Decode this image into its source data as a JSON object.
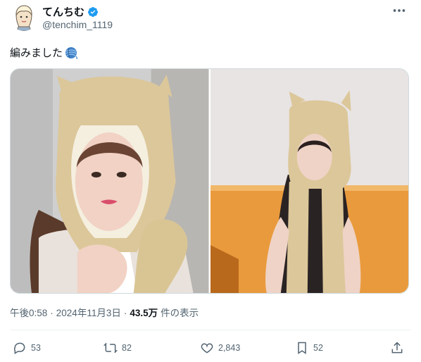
{
  "author": {
    "display_name": "てんちむ",
    "handle": "@tenchim_1119",
    "verified": true,
    "avatar_icon": "illustrated-avatar"
  },
  "tweet": {
    "text": "編みました",
    "emoji_icon": "yarn-ball-icon",
    "image_count": 2
  },
  "meta": {
    "time": "午後0:58",
    "separator": "·",
    "date": "2024年11月3日",
    "views_count": "43.5万",
    "views_label": "件の表示"
  },
  "actions": {
    "replies": "53",
    "reposts": "82",
    "likes": "2,843",
    "bookmarks": "52"
  },
  "colors": {
    "text": "#0f1419",
    "muted": "#536471",
    "verified": "#1d9bf0",
    "border": "#cfd9de"
  }
}
